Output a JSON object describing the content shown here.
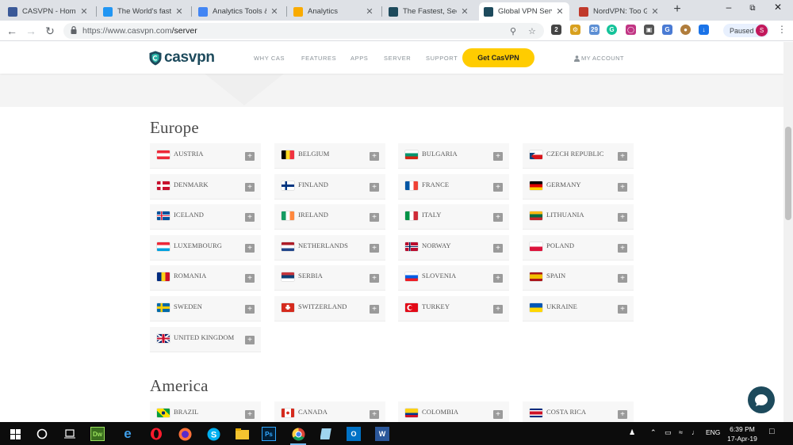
{
  "browser": {
    "tabs": [
      {
        "title": "CASVPN - Home |",
        "icon": "facebook-icon",
        "color": "#3b5998"
      },
      {
        "title": "The World's fastest",
        "icon": "speed-icon",
        "color": "#2196f3"
      },
      {
        "title": "Analytics Tools & S",
        "icon": "google-icon",
        "color": "#4285f4"
      },
      {
        "title": "Analytics",
        "icon": "analytics-icon",
        "color": "#f9ab00"
      },
      {
        "title": "The Fastest, Secure",
        "icon": "casvpn-shield-icon",
        "color": "#1d4a5c"
      },
      {
        "title": "Global VPN Server",
        "icon": "casvpn-shield-icon",
        "color": "#1d4a5c"
      },
      {
        "title": "NordVPN: Too Go",
        "icon": "nordvpn-shield-icon",
        "color": "#c0392b"
      }
    ],
    "url_host": "https://www.casvpn.com",
    "url_path": "/server",
    "paused_label": "Paused",
    "avatar_letter": "S"
  },
  "site": {
    "logo_text": "casvpn",
    "nav": [
      "WHY CAS",
      "FEATURES",
      "APPS",
      "SERVER",
      "SUPPORT"
    ],
    "cta": "Get CasVPN",
    "account": "MY ACCOUNT"
  },
  "regions": [
    {
      "title": "Europe",
      "countries": [
        "AUSTRIA",
        "BELGIUM",
        "BULGARIA",
        "CZECH REPUBLIC",
        "DENMARK",
        "FINLAND",
        "FRANCE",
        "GERMANY",
        "ICELAND",
        "IRELAND",
        "ITALY",
        "LITHUANIA",
        "LUXEMBOURG",
        "NETHERLANDS",
        "NORWAY",
        "POLAND",
        "ROMANIA",
        "SERBIA",
        "SLOVENIA",
        "SPAIN",
        "SWEDEN",
        "SWITZERLAND",
        "TURKEY",
        "UKRAINE",
        "UNITED KINGDOM"
      ]
    },
    {
      "title": "America",
      "countries": [
        "BRAZIL",
        "CANADA",
        "COLOMBIA",
        "COSTA RICA"
      ]
    }
  ],
  "taskbar": {
    "time": "6:39 PM",
    "date": "17-Apr-19",
    "lang": "ENG"
  },
  "colors": {
    "brand": "#1d4a5c",
    "cta": "#ffcc00"
  }
}
